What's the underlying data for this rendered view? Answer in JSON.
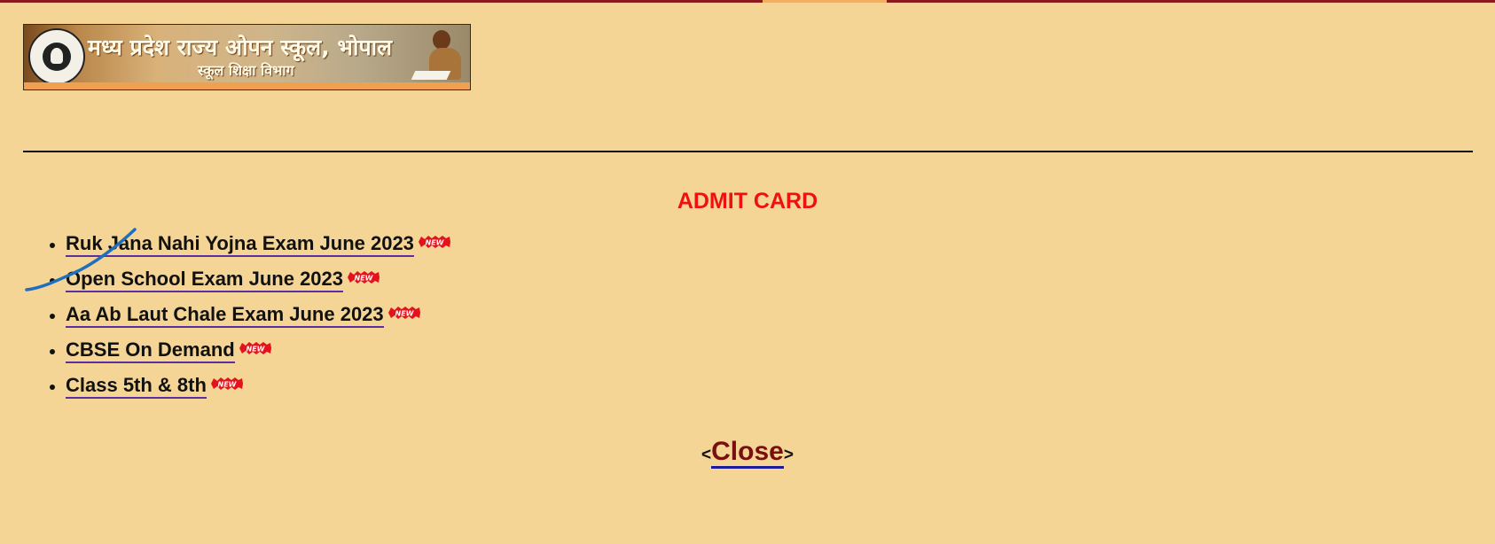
{
  "banner": {
    "title": "मध्य प्रदेश राज्य ओपन स्कूल, भोपाल",
    "subtitle": "स्कूल शिक्षा विभाग"
  },
  "heading": "ADMIT CARD",
  "admit_cards": [
    {
      "label": "Ruk Jana Nahi Yojna Exam June 2023",
      "badge": "NEW"
    },
    {
      "label": "Open School Exam June 2023",
      "badge": "NEW"
    },
    {
      "label": "Aa Ab Laut Chale Exam June 2023",
      "badge": "NEW"
    },
    {
      "label": "CBSE On Demand",
      "badge": "NEW"
    },
    {
      "label": "Class 5th & 8th",
      "badge": "NEW"
    }
  ],
  "close": {
    "open_bracket": "<",
    "label": "Close",
    "close_bracket": ">"
  },
  "colors": {
    "background": "#f4d595",
    "heading": "#ee1111",
    "close_link": "#7a0f0f",
    "badge": "#e3121b",
    "annotation_stroke": "#1f6fbf"
  }
}
